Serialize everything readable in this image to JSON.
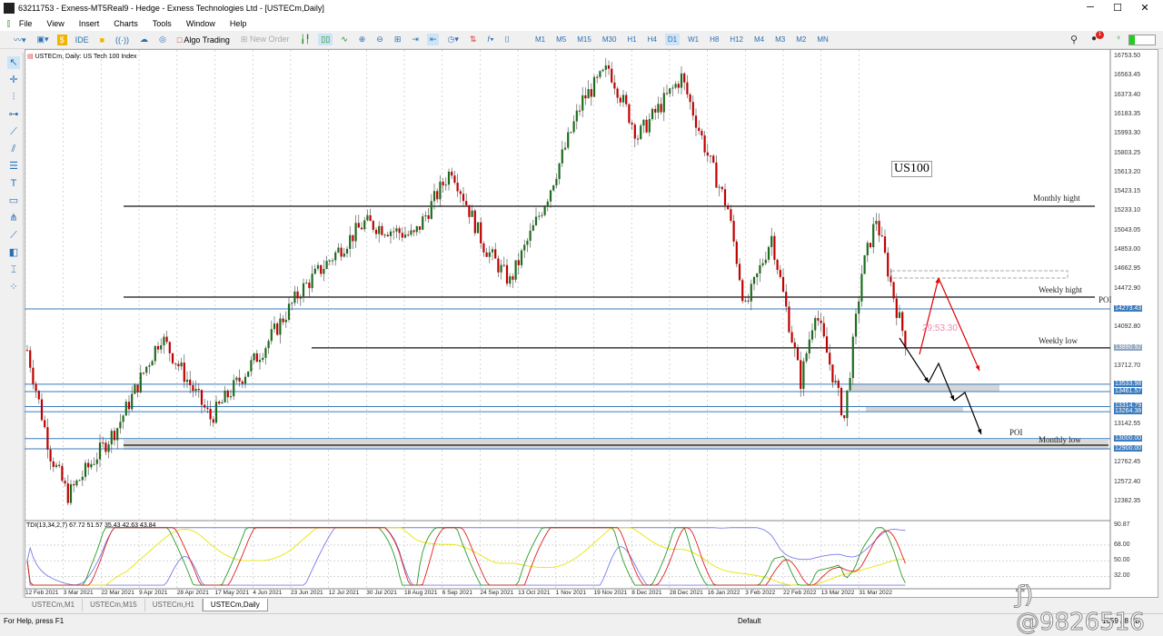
{
  "window": {
    "title": "63211753 - Exness-MT5Real9 - Hedge - Exness Technologies Ltd - [USTECm,Daily]"
  },
  "menu": [
    "File",
    "View",
    "Insert",
    "Charts",
    "Tools",
    "Window",
    "Help"
  ],
  "toolbar": {
    "ide": "IDE",
    "algo_trading": "Algo Trading",
    "new_order": "New Order",
    "timeframes": [
      "M1",
      "M5",
      "M15",
      "M30",
      "H1",
      "H4",
      "D1",
      "W1",
      "H8",
      "H12",
      "M4",
      "M3",
      "M2",
      "MN"
    ],
    "active_timeframe": "D1",
    "notification_count": "1"
  },
  "chart": {
    "header": "USTECm, Daily:  US Tech 100 Index",
    "price_ticks": [
      "16753.50",
      "16563.45",
      "16373.40",
      "16183.35",
      "15993.30",
      "15803.25",
      "15613.20",
      "15423.15",
      "15233.10",
      "15043.05",
      "14853.00",
      "14662.95",
      "14472.90",
      "14092.80",
      "13712.70",
      "13142.55",
      "12762.45",
      "12572.40",
      "12382.35"
    ],
    "price_tags": [
      "14273.43",
      "13890.92",
      "13533.98",
      "13461.57",
      "13314.79",
      "13264.38",
      "13000.00",
      "12900.00"
    ],
    "date_ticks": [
      "12 Feb 2021",
      "3 Mar 2021",
      "22 Mar 2021",
      "9 Apr 2021",
      "28 Apr 2021",
      "17 May 2021",
      "4 Jun 2021",
      "23 Jun 2021",
      "12 Jul 2021",
      "30 Jul 2021",
      "18 Aug 2021",
      "6 Sep 2021",
      "24 Sep 2021",
      "13 Oct 2021",
      "1 Nov 2021",
      "19 Nov 2021",
      "8 Dec 2021",
      "28 Dec 2021",
      "16 Jan 2022",
      "3 Feb 2022",
      "22 Feb 2022",
      "13 Mar 2022",
      "31 Mar 2022"
    ],
    "annotations": {
      "symbol_box": "US100",
      "monthly_high": "Monthly hight",
      "weekly_high": "Weekly hight",
      "poi_top": "POI",
      "weekly_low": "Weekly low",
      "poi_bottom": "POI",
      "monthly_low": "Monthly low",
      "timer": "29:53.30"
    },
    "indicator": {
      "label": "TDI(13,34,2,7) 67.72 51.57 35.43 42.63 43.84",
      "ticks": [
        "90.87",
        "68.00",
        "50.00",
        "32.00"
      ]
    },
    "colors": {
      "bull": "#1e6b1e",
      "bear": "#c00000",
      "level": "#3b7bbf",
      "arrow_red": "#e00000"
    }
  },
  "chart_data": {
    "type": "candlestick",
    "price_range": [
      12382.35,
      16753.5
    ],
    "waypoints": [
      [
        0,
        13870
      ],
      [
        8,
        12845
      ],
      [
        14,
        12444
      ],
      [
        31,
        13113
      ],
      [
        46,
        14005
      ],
      [
        63,
        13200
      ],
      [
        82,
        13916
      ],
      [
        94,
        14451
      ],
      [
        116,
        15120
      ],
      [
        133,
        14987
      ],
      [
        146,
        15656
      ],
      [
        157,
        14897
      ],
      [
        166,
        14540
      ],
      [
        179,
        15388
      ],
      [
        191,
        16325
      ],
      [
        200,
        16637
      ],
      [
        210,
        15968
      ],
      [
        225,
        16548
      ],
      [
        235,
        15700
      ],
      [
        241,
        15254
      ],
      [
        247,
        14273
      ],
      [
        256,
        14987
      ],
      [
        266,
        13560
      ],
      [
        271,
        14270
      ],
      [
        281,
        13200
      ],
      [
        287,
        14630
      ],
      [
        292,
        15165
      ],
      [
        299,
        14273
      ],
      [
        302,
        13960
      ]
    ]
  },
  "tabs": [
    "USTECm,M1",
    "USTECm,M15",
    "USTECm,H1",
    "USTECm,Daily"
  ],
  "status": {
    "help": "For Help, press F1",
    "profile": "Default",
    "traffic": "1059 / 8 Kb",
    "watermark": "@9826516"
  }
}
